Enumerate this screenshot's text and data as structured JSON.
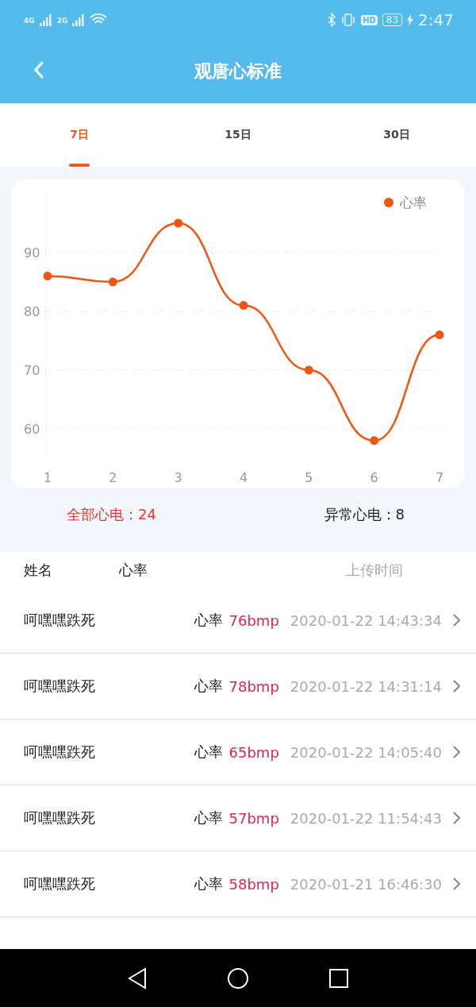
{
  "status_bar": {
    "network_1": "4G",
    "network_2": "2G",
    "hd": "HD",
    "battery": "83",
    "time": "2:47"
  },
  "header": {
    "title": "观唐心标准"
  },
  "tabs": [
    {
      "label": "7日",
      "selected": true
    },
    {
      "label": "15日",
      "selected": false
    },
    {
      "label": "30日",
      "selected": false
    }
  ],
  "chart_data": {
    "type": "line",
    "grid": true,
    "marker": true,
    "categories": [
      "1",
      "2",
      "3",
      "4",
      "5",
      "6",
      "7"
    ],
    "ylim": [
      55,
      100
    ],
    "yticks": [
      60,
      70,
      80,
      90
    ],
    "series": [
      {
        "name": "心率",
        "color": "#f0560f",
        "values": [
          86,
          85,
          95,
          81,
          70,
          58,
          76
        ]
      }
    ]
  },
  "summary": {
    "total": "全部心电：24",
    "abnormal": "异常心电：8"
  },
  "list_header": {
    "name": "姓名",
    "heart_rate": "心率",
    "upload_time": "上传时间"
  },
  "records": [
    {
      "name": "呵嘿嘿跌死",
      "label": "心率",
      "value": "76bmp",
      "time": "2020-01-22 14:43:34"
    },
    {
      "name": "呵嘿嘿跌死",
      "label": "心率",
      "value": "78bmp",
      "time": "2020-01-22 14:31:14"
    },
    {
      "name": "呵嘿嘿跌死",
      "label": "心率",
      "value": "65bmp",
      "time": "2020-01-22 14:05:40"
    },
    {
      "name": "呵嘿嘿跌死",
      "label": "心率",
      "value": "57bmp",
      "time": "2020-01-22 11:54:43"
    },
    {
      "name": "呵嘿嘿跌死",
      "label": "心率",
      "value": "58bmp",
      "time": "2020-01-21 16:46:30"
    }
  ]
}
